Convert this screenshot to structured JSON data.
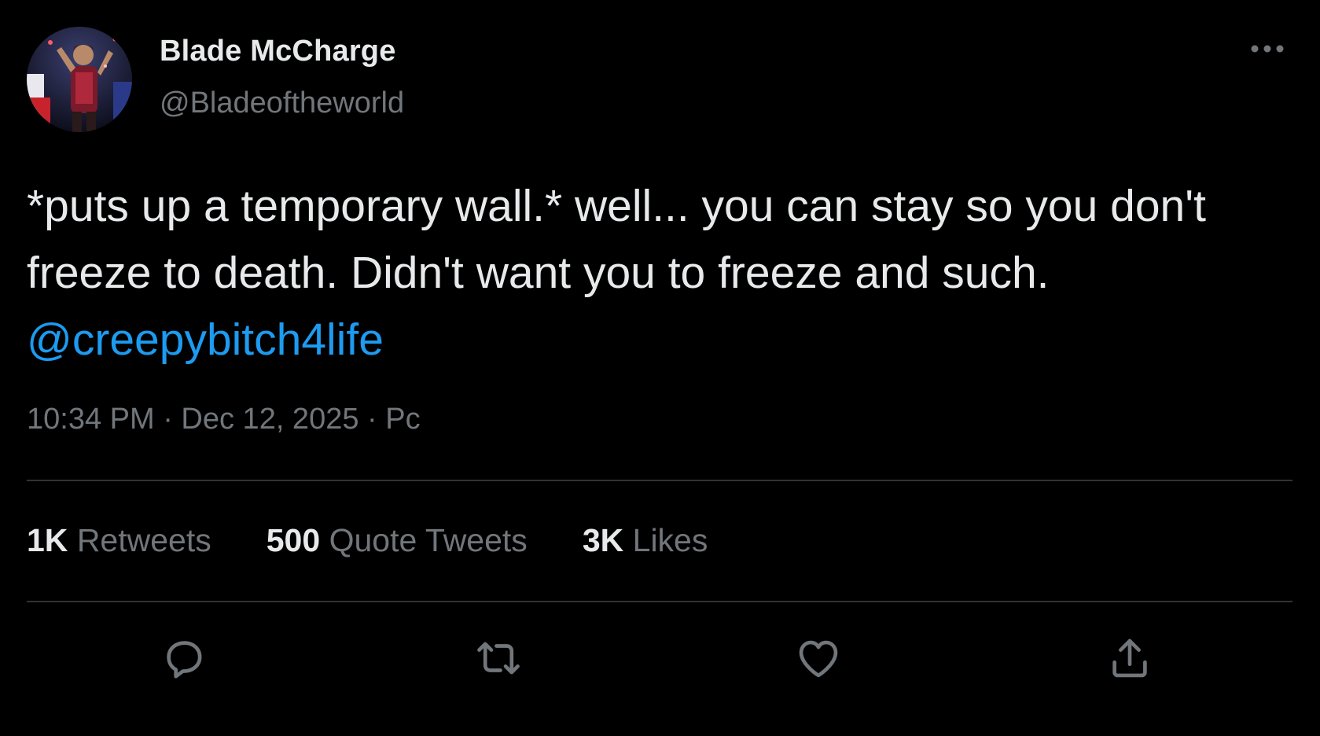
{
  "author": {
    "display_name": "Blade McCharge",
    "handle": "@Bladeoftheworld",
    "avatar_icon": "profile-photo"
  },
  "tweet": {
    "text": "*puts up a temporary wall.* well... you can stay so you don't freeze to death. Didn't want you to freeze and such. ",
    "mention": "@creepybitch4life",
    "meta": "10:34 PM · Dec 12, 2025 · Pc"
  },
  "stats": {
    "retweets_count": "1K",
    "retweets_label": "Retweets",
    "quotes_count": "500",
    "quotes_label": "Quote Tweets",
    "likes_count": "3K",
    "likes_label": "Likes"
  },
  "actions": [
    {
      "icon": "reply-icon"
    },
    {
      "icon": "retweet-icon"
    },
    {
      "icon": "like-icon"
    },
    {
      "icon": "share-icon"
    }
  ],
  "colors": {
    "background": "#000000",
    "text": "#e7e9ea",
    "secondary": "#71767b",
    "link": "#1d9bf0",
    "divider": "#2f3336"
  }
}
